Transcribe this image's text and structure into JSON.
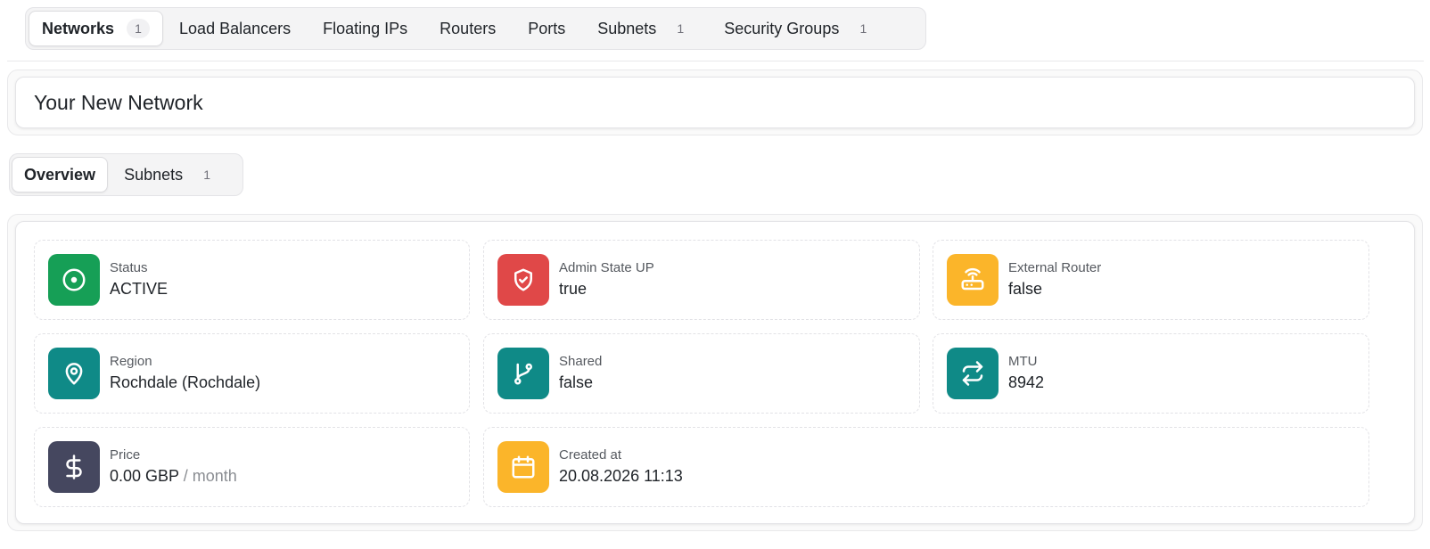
{
  "top_tabs": [
    {
      "label": "Networks",
      "badge": "1"
    },
    {
      "label": "Load Balancers",
      "badge": ""
    },
    {
      "label": "Floating IPs",
      "badge": ""
    },
    {
      "label": "Routers",
      "badge": ""
    },
    {
      "label": "Ports",
      "badge": ""
    },
    {
      "label": "Subnets",
      "badge": "1"
    },
    {
      "label": "Security Groups",
      "badge": "1"
    }
  ],
  "network": {
    "title": "Your New Network"
  },
  "sub_tabs": [
    {
      "label": "Overview",
      "badge": ""
    },
    {
      "label": "Subnets",
      "badge": "1"
    }
  ],
  "details": {
    "status": {
      "label": "Status",
      "value": "ACTIVE",
      "icon": "status-circle-icon",
      "color": "#169f56"
    },
    "admin_state": {
      "label": "Admin State UP",
      "value": "true",
      "icon": "shield-check-icon",
      "color": "#e04848"
    },
    "external_router": {
      "label": "External Router",
      "value": "false",
      "icon": "router-icon",
      "color": "#fbb52a"
    },
    "region": {
      "label": "Region",
      "value": "Rochdale (Rochdale)",
      "icon": "map-pin-icon",
      "color": "#0f8a87"
    },
    "shared": {
      "label": "Shared",
      "value": "false",
      "icon": "git-branch-icon",
      "color": "#0f8a87"
    },
    "mtu": {
      "label": "MTU",
      "value": "8942",
      "icon": "repeat-arrows-icon",
      "color": "#0f8a87"
    },
    "price": {
      "label": "Price",
      "value": "0.00 GBP",
      "unit": "/ month",
      "icon": "dollar-icon",
      "color": "#45475f"
    },
    "created_at": {
      "label": "Created at",
      "value": "20.08.2026 11:13",
      "icon": "calendar-icon",
      "color": "#fbb52a"
    }
  }
}
